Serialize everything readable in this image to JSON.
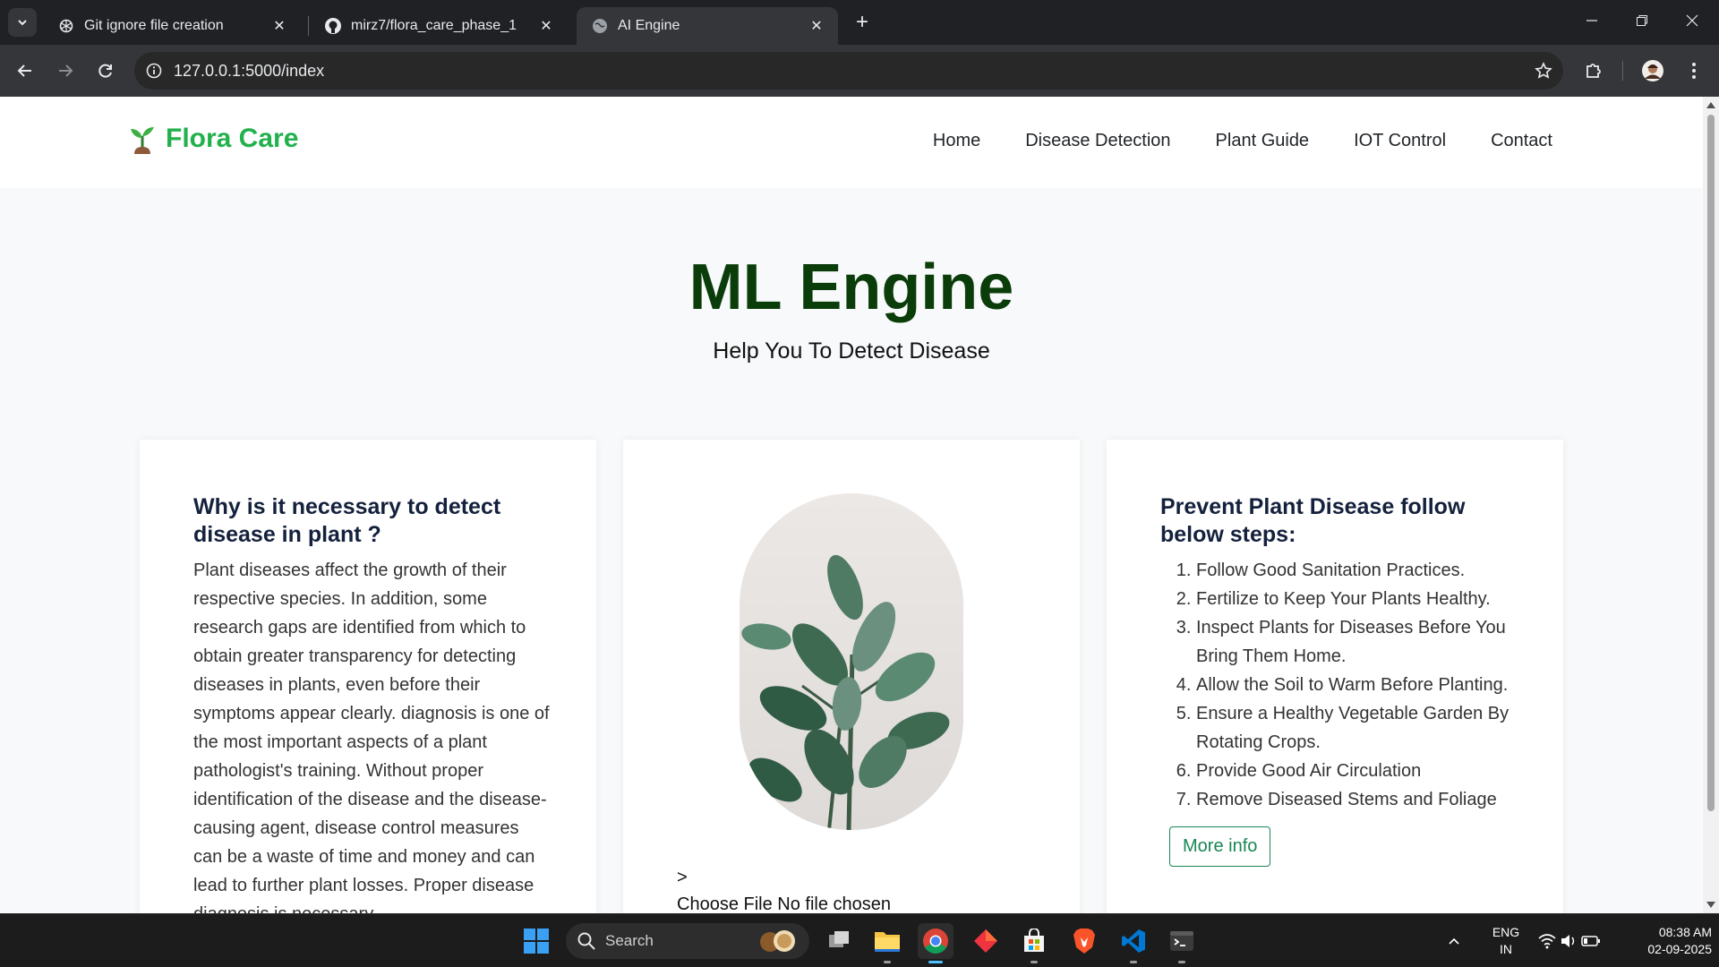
{
  "browser": {
    "tabs": [
      {
        "title": "Git ignore file creation",
        "icon": "openai-icon"
      },
      {
        "title": "mirz7/flora_care_phase_1",
        "icon": "github-icon"
      },
      {
        "title": "AI Engine",
        "icon": "globe-icon"
      }
    ],
    "url": "127.0.0.1:5000/index"
  },
  "site": {
    "brand": "Flora Care",
    "nav": [
      "Home",
      "Disease Detection",
      "Plant Guide",
      "IOT Control",
      "Contact"
    ],
    "hero_title": "ML Engine",
    "hero_subtitle": "Help You To Detect Disease"
  },
  "card_why": {
    "heading": "Why is it necessary to detect disease in plant ?",
    "body": "Plant diseases affect the growth of their respective species. In addition, some research gaps are identified from which to obtain greater transparency for detecting diseases in plants, even before their symptoms appear clearly. diagnosis is one of the most important aspects of a plant pathologist's training. Without proper identification of the disease and the disease-causing agent, disease control measures can be a waste of time and money and can lead to further plant losses. Proper disease diagnosis is necessary."
  },
  "card_upload": {
    "marker": ">",
    "choose_file": "Choose File",
    "file_status": "No file chosen"
  },
  "card_prevent": {
    "heading": "Prevent Plant Disease follow below steps:",
    "steps": [
      "Follow Good Sanitation Practices.",
      "Fertilize to Keep Your Plants Healthy.",
      "Inspect Plants for Diseases Before You Bring Them Home.",
      "Allow the Soil to Warm Before Planting.",
      "Ensure a Healthy Vegetable Garden By Rotating Crops.",
      "Provide Good Air Circulation",
      "Remove Diseased Stems and Foliage"
    ],
    "more_info": "More info"
  },
  "taskbar": {
    "search": "Search",
    "lang_top": "ENG",
    "lang_bottom": "IN",
    "time": "08:38 AM",
    "date": "02-09-2025"
  },
  "colors": {
    "brand_green": "#22b14c",
    "hero_dark_green": "#0a3d0a",
    "button_green": "#198754"
  }
}
